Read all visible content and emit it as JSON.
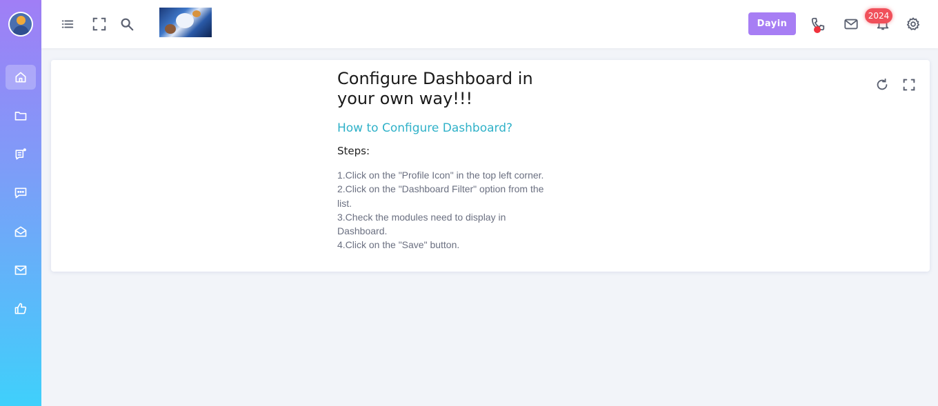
{
  "sidebar": {
    "profile": "profile-avatar",
    "items": [
      {
        "icon": "home-icon",
        "active": true
      },
      {
        "icon": "folder-icon",
        "active": false
      },
      {
        "icon": "notes-icon",
        "active": false
      },
      {
        "icon": "chat-icon",
        "active": false
      },
      {
        "icon": "mail-open-icon",
        "active": false
      },
      {
        "icon": "mail-icon",
        "active": false
      },
      {
        "icon": "thumbs-up-icon",
        "active": false
      }
    ]
  },
  "header": {
    "user_label": "Dayin",
    "notification_count": "2024",
    "accent_color": "#a77ef4"
  },
  "card": {
    "title": "Configure Dashboard in your own way!!!",
    "subtitle": "How to Configure Dashboard?",
    "steps_title": "Steps:",
    "steps": [
      "1.Click on the \"Profile Icon\" in the top left corner.",
      "2.Click on the \"Dashboard Filter\" option from the list.",
      "3.Check the modules need to display in Dashboard.",
      "4.Click on the \"Save\" button."
    ]
  }
}
